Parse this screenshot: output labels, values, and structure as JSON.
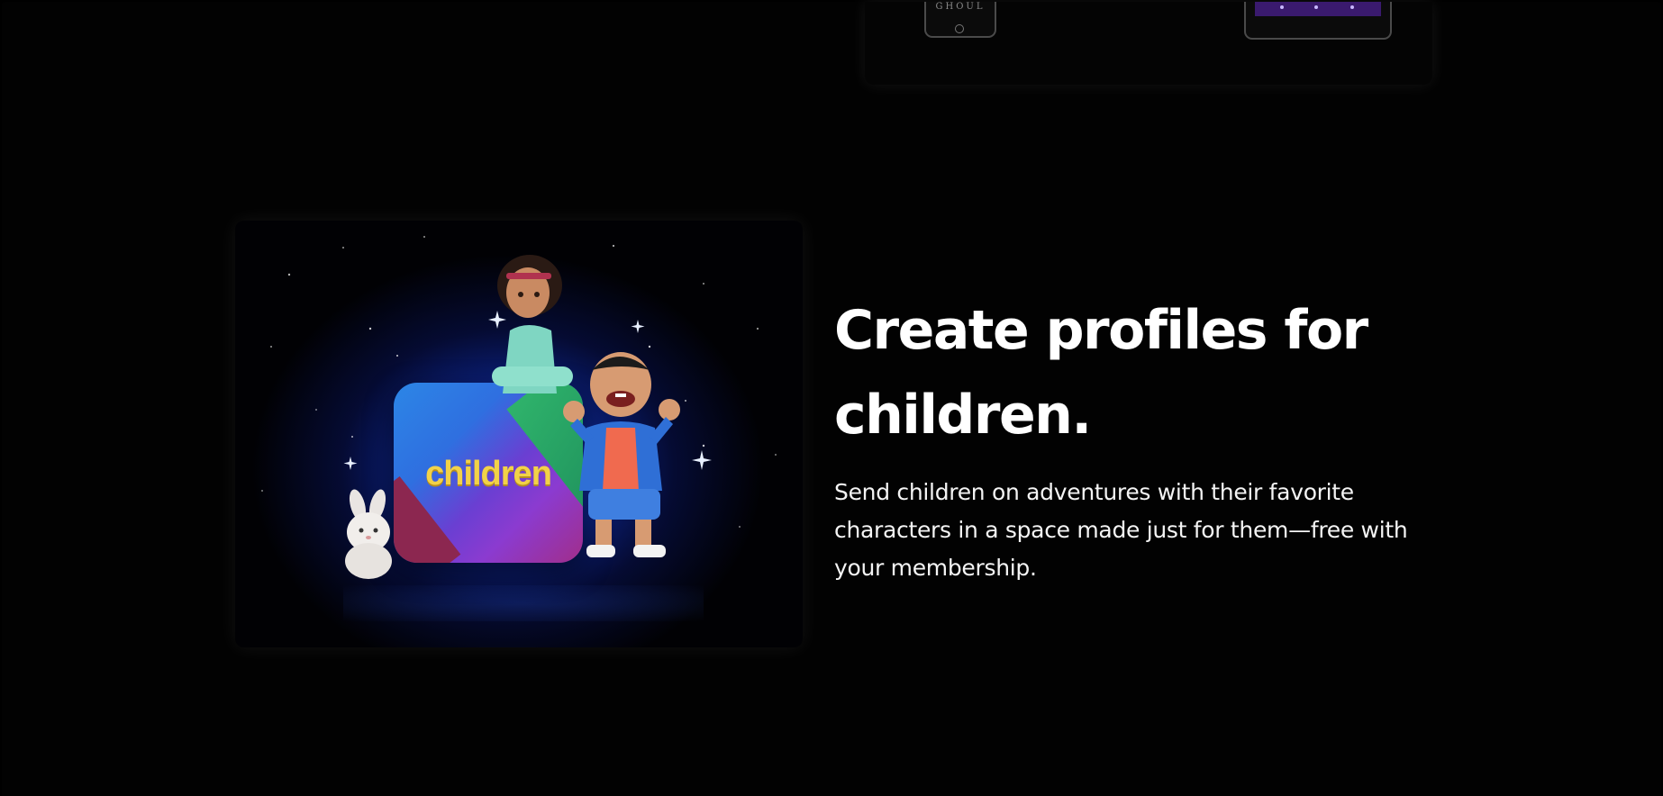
{
  "feature": {
    "image_tile_label": "children",
    "headline": "Create profiles for children.",
    "description": "Send children on adventures with their favorite characters in a space made just for them—free with your membership."
  },
  "top_card": {
    "phone_label": "GHOUL"
  },
  "colors": {
    "background": "#000000",
    "text_primary": "#ffffff",
    "tile_label": "#f2d248",
    "glow_blue": "#1b3fb0"
  }
}
